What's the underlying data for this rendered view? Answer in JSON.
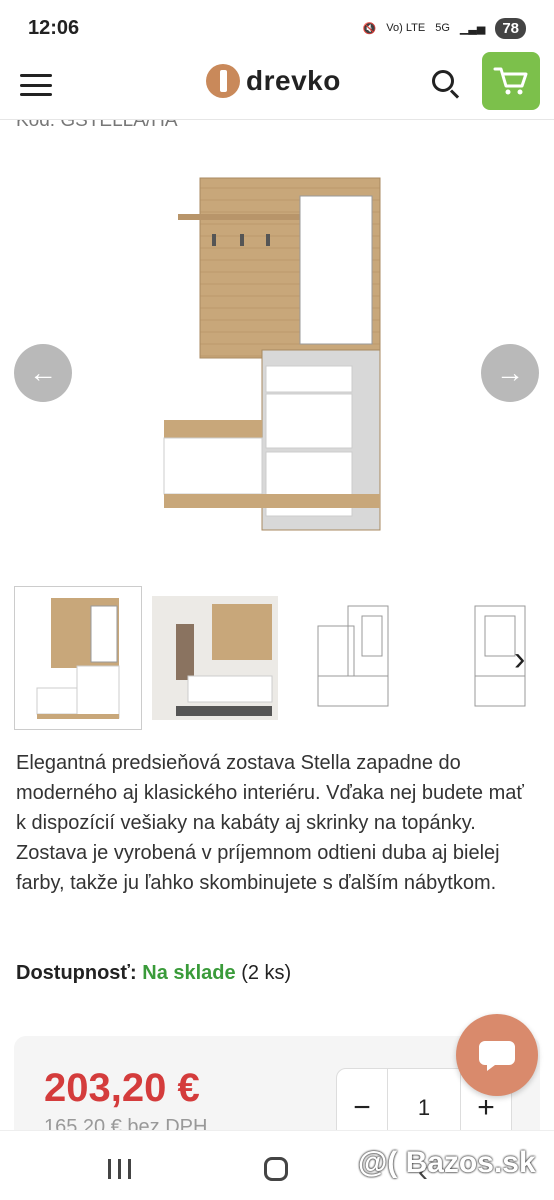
{
  "status_bar": {
    "time": "12:06",
    "network": "Vo) LTE",
    "signal": "5G",
    "battery": "78"
  },
  "header": {
    "logo_text": "drevko"
  },
  "product": {
    "code_partial": "Kód: GSTELLA/HA",
    "description": "Elegantná predsieňová zostava Stella zapadne do moderného aj klasického interiéru. Vďaka nej budete mať k dispozícií vešiaky na kabáty aj skrinky na topánky. Zostava je vyrobená v príjemnom odtieni duba aj bielej farby, takže ju ľahko skombinujete s ďalším nábytkom.",
    "availability_label": "Dostupnosť:",
    "availability_status": "Na sklade",
    "availability_count": "(2 ks)",
    "price": "203,20 €",
    "price_net": "165,20 € bez DPH",
    "quantity": "1"
  },
  "quantity_controls": {
    "minus": "−",
    "plus": "+"
  },
  "watermark": "@( Bazos.sk",
  "colors": {
    "accent_green": "#7cc04b",
    "price_red": "#d43c3c",
    "stock_green": "#3a9b3a",
    "chat_button": "#d98a6c"
  }
}
